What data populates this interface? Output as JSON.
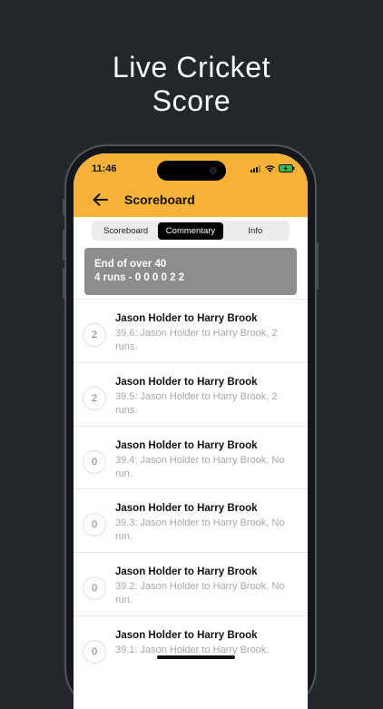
{
  "headline": {
    "line1": "Live Cricket",
    "line2": "Score"
  },
  "status_bar": {
    "time": "11:46"
  },
  "nav": {
    "title": "Scoreboard",
    "back_icon": "back-arrow-icon"
  },
  "tabs": [
    {
      "label": "Scoreboard",
      "active": false
    },
    {
      "label": "Commentary",
      "active": true
    },
    {
      "label": "Info",
      "active": false
    }
  ],
  "over_summary": {
    "line1": "End of over 40",
    "line2": "4 runs - 0 0 0 0 2 2"
  },
  "commentary": [
    {
      "runs": "2",
      "title": "Jason Holder to Harry Brook",
      "desc": "39.6: Jason Holder to Harry Brook, 2 runs."
    },
    {
      "runs": "2",
      "title": "Jason Holder to Harry Brook",
      "desc": "39.5: Jason Holder to Harry Brook, 2 runs."
    },
    {
      "runs": "0",
      "title": "Jason Holder to Harry Brook",
      "desc": "39.4: Jason Holder to Harry Brook, No run."
    },
    {
      "runs": "0",
      "title": "Jason Holder to Harry Brook",
      "desc": "39.3: Jason Holder to Harry Brook, No run."
    },
    {
      "runs": "0",
      "title": "Jason Holder to Harry Brook",
      "desc": "39.2: Jason Holder to Harry Brook, No run."
    },
    {
      "runs": "0",
      "title": "Jason Holder to Harry Brook",
      "desc": "39.1: Jason Holder to Harry Brook,"
    }
  ],
  "colors": {
    "accent": "#f8b23a",
    "page_background": "#23262b",
    "over_card": "#8d8d8d"
  }
}
